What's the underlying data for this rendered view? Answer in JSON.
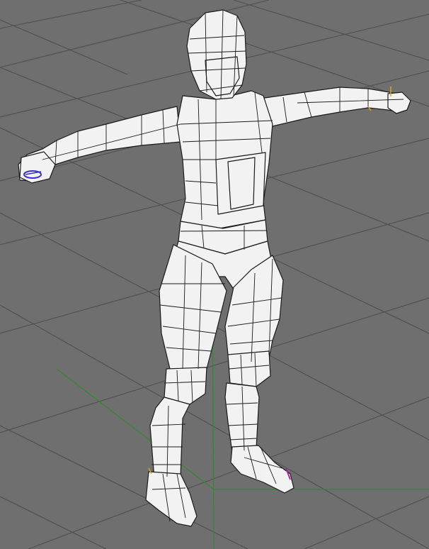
{
  "viewport": {
    "name": "3d-perspective-viewport",
    "background": "#6f6f6f",
    "grid_color": "#505050",
    "mesh_fill": "#f2f2f2",
    "wire_color": "#1a1a1a",
    "axis_color": "#2f8a2f"
  },
  "model": {
    "type": "low-poly humanoid character, T-pose, wireframe on shaded",
    "handles": [
      {
        "name": "left-hand-ik-handle",
        "color": "#3a2fd0"
      },
      {
        "name": "right-hand-pivot-marker",
        "color": "#e0a020"
      },
      {
        "name": "right-foot-pivot-marker",
        "color": "#b01fb0"
      }
    ]
  }
}
